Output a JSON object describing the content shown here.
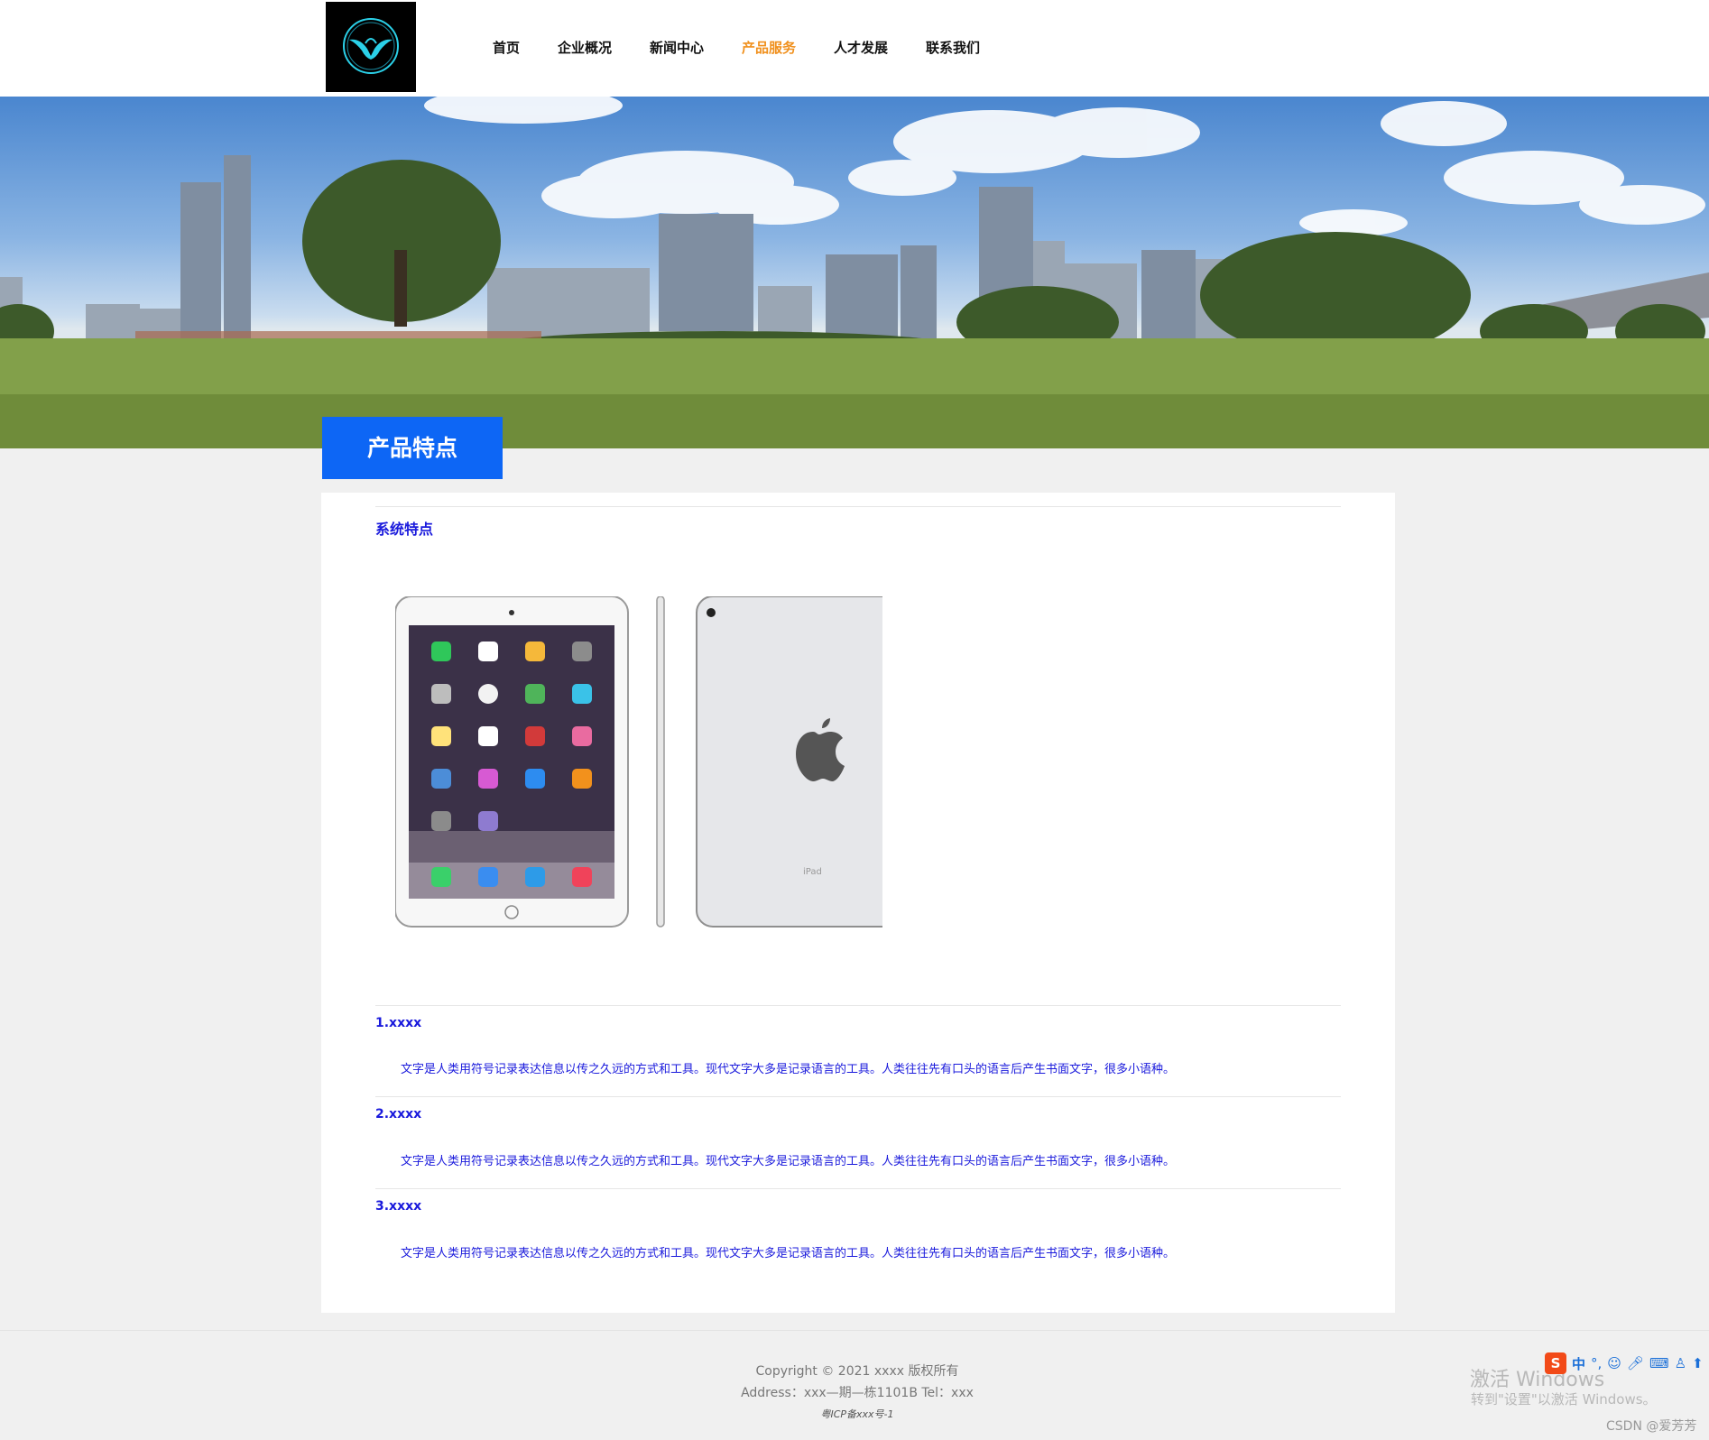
{
  "header": {
    "nav": [
      {
        "label": "首页",
        "active": false
      },
      {
        "label": "企业概况",
        "active": false
      },
      {
        "label": "新闻中心",
        "active": false
      },
      {
        "label": "产品服务",
        "active": true
      },
      {
        "label": "人才发展",
        "active": false
      },
      {
        "label": "联系我们",
        "active": false
      }
    ],
    "active_color": "#f0901d"
  },
  "section": {
    "tab_label": "产品特点",
    "tab_color": "#0d66f5"
  },
  "content": {
    "subtitle": "系统特点",
    "text_color": "#1a1adc",
    "product_image_label": "iPad",
    "features": [
      {
        "title": "1.xxxx",
        "desc": "文字是人类用符号记录表达信息以传之久远的方式和工具。现代文字大多是记录语言的工具。人类往往先有口头的语言后产生书面文字，很多小语种。"
      },
      {
        "title": "2.xxxx",
        "desc": "文字是人类用符号记录表达信息以传之久远的方式和工具。现代文字大多是记录语言的工具。人类往往先有口头的语言后产生书面文字，很多小语种。"
      },
      {
        "title": "3.xxxx",
        "desc": "文字是人类用符号记录表达信息以传之久远的方式和工具。现代文字大多是记录语言的工具。人类往往先有口头的语言后产生书面文字，很多小语种。"
      }
    ]
  },
  "footer": {
    "copyright": "Copyright © 2021 xxxx 版权所有",
    "address": "Address：xxx—期—栋1101B Tel：xxx",
    "icp": "粤ICP备xxx号-1"
  },
  "overlay": {
    "ime_s": "S",
    "ime_zh": "中",
    "ime_punct": "°,",
    "watermark_line1": "激活 Windows",
    "watermark_line2": "转到\"设置\"以激活 Windows。",
    "csdn": "CSDN @爱芳芳"
  }
}
